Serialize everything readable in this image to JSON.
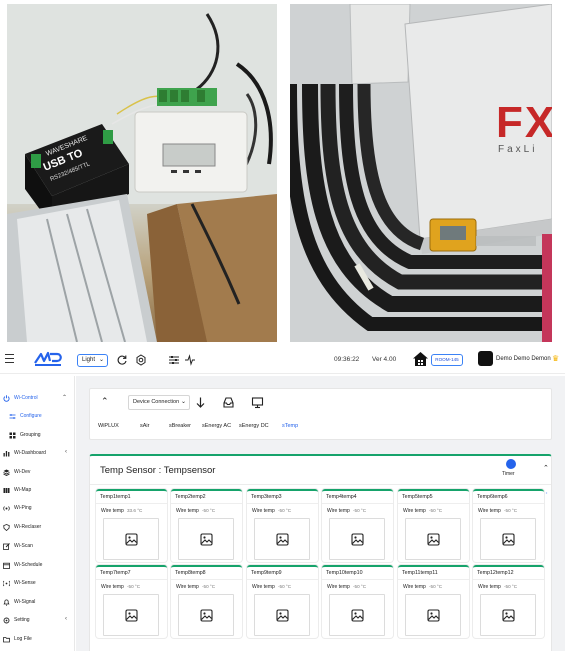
{
  "topbar": {
    "theme_label": "Light",
    "time": "09:36:22",
    "version": "Ver 4.00",
    "room": "ROOM-145",
    "user": "Demo Demo Demon"
  },
  "sidebar": {
    "items": [
      {
        "label": "Wi-Control",
        "name": "sidebar-item-wi-control",
        "icon": "power-icon",
        "active": true,
        "arrow": "chevron-up"
      },
      {
        "label": "Configure",
        "name": "sidebar-item-configure",
        "icon": "sliders-icon",
        "active": true,
        "sub": true
      },
      {
        "label": "Grouping",
        "name": "sidebar-item-grouping",
        "icon": "grid-icon",
        "sub": true
      },
      {
        "label": "Wi-Dashboard",
        "name": "sidebar-item-wi-dashboard",
        "icon": "bar-chart-icon",
        "arrow": "chevron-left"
      },
      {
        "label": "Wi-Dev",
        "name": "sidebar-item-wi-dev",
        "icon": "layers-icon"
      },
      {
        "label": "Wi-Map",
        "name": "sidebar-item-wi-map",
        "icon": "map-icon"
      },
      {
        "label": "Wi-Ping",
        "name": "sidebar-item-wi-ping",
        "icon": "signal-icon"
      },
      {
        "label": "Wi-Reclaser",
        "name": "sidebar-item-wi-reclaser",
        "icon": "shield-icon"
      },
      {
        "label": "Wi-Scan",
        "name": "sidebar-item-wi-scan",
        "icon": "edit-icon"
      },
      {
        "label": "Wi-Schedule",
        "name": "sidebar-item-wi-schedule",
        "icon": "calendar-icon"
      },
      {
        "label": "Wi-Sense",
        "name": "sidebar-item-wi-sense",
        "icon": "broadcast-icon"
      },
      {
        "label": "Wi-Signal",
        "name": "sidebar-item-wi-signal",
        "icon": "bell-icon"
      },
      {
        "label": "Setting",
        "name": "sidebar-item-setting",
        "icon": "gear-icon",
        "arrow": "chevron-left"
      },
      {
        "label": "Log File",
        "name": "sidebar-item-log-file",
        "icon": "folder-icon"
      }
    ]
  },
  "device_panel": {
    "select_label": "Device Connection",
    "tabs": [
      "WiPLUX",
      "sAir",
      "sBreaker",
      "sEnergy AC",
      "sEnergy DC",
      "sTemp"
    ],
    "active_tab": "sTemp"
  },
  "sensor_panel": {
    "title": "Temp Sensor : Tempsensor",
    "timer_label": "Timer",
    "cards": [
      {
        "title": "Temp1temp1",
        "label": "Wire temp",
        "value": "33.6 °C"
      },
      {
        "title": "Temp2temp2",
        "label": "Wire temp",
        "value": "-50 °C"
      },
      {
        "title": "Temp3temp3",
        "label": "Wire temp",
        "value": "-50 °C"
      },
      {
        "title": "Temp4temp4",
        "label": "Wire temp",
        "value": "-50 °C"
      },
      {
        "title": "Temp5temp5",
        "label": "Wire temp",
        "value": "-50 °C"
      },
      {
        "title": "Temp6temp6",
        "label": "Wire temp",
        "value": "-50 °C"
      },
      {
        "title": "Temp7temp7",
        "label": "Wire temp",
        "value": "-50 °C"
      },
      {
        "title": "Temp8temp8",
        "label": "Wire temp",
        "value": "-50 °C"
      },
      {
        "title": "Temp9temp9",
        "label": "Wire temp",
        "value": "-50 °C"
      },
      {
        "title": "Temp10temp10",
        "label": "Wire temp",
        "value": "-50 °C"
      },
      {
        "title": "Temp11temp11",
        "label": "Wire temp",
        "value": "-50 °C"
      },
      {
        "title": "Temp12temp12",
        "label": "Wire temp",
        "value": "-50 °C"
      }
    ]
  },
  "photos": {
    "left_device_text": "USB TO RS232/485/TTL",
    "left_brand": "WAVESHARE",
    "right_logo": "FX",
    "right_logo_sub": "FaxLi"
  },
  "colors": {
    "accent": "#2563eb",
    "card_border": "#16a36b",
    "sidebar_active": "#2563eb"
  }
}
